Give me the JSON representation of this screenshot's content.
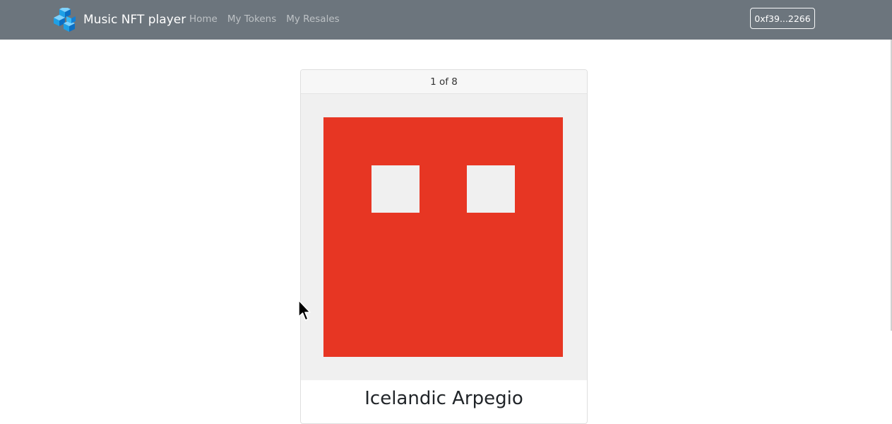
{
  "navbar": {
    "brand_name": "Music NFT player",
    "links": [
      {
        "label": "Home"
      },
      {
        "label": "My Tokens"
      },
      {
        "label": "My Resales"
      }
    ],
    "account_label": "0xf39...2266",
    "background_color": "#6c757d"
  },
  "card": {
    "counter": "1 of 8",
    "title": "Icelandic Arpegio",
    "artwork": {
      "icon": "pixel-face-art",
      "background_color": "#e73623",
      "eye_color": "#f0f0f0"
    }
  }
}
